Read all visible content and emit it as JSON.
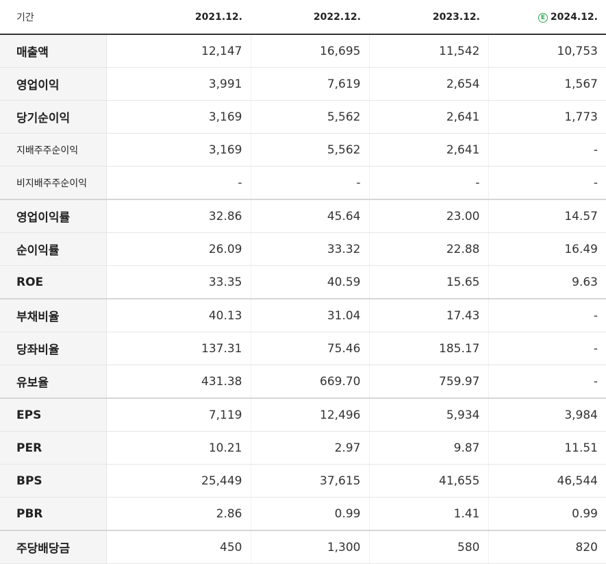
{
  "header": {
    "label": "기간",
    "periods": [
      "2021.12.",
      "2022.12.",
      "2023.12.",
      "2024.12."
    ],
    "estimate_badge": "E"
  },
  "rows": [
    {
      "label": "매출액",
      "values": [
        "12,147",
        "16,695",
        "11,542",
        "10,753"
      ]
    },
    {
      "label": "영업이익",
      "values": [
        "3,991",
        "7,619",
        "2,654",
        "1,567"
      ]
    },
    {
      "label": "당기순이익",
      "values": [
        "3,169",
        "5,562",
        "2,641",
        "1,773"
      ]
    },
    {
      "label": "지배주주순이익",
      "values": [
        "3,169",
        "5,562",
        "2,641",
        "-"
      ]
    },
    {
      "label": "비지배주주순이익",
      "values": [
        "-",
        "-",
        "-",
        "-"
      ]
    },
    {
      "label": "영업이익률",
      "values": [
        "32.86",
        "45.64",
        "23.00",
        "14.57"
      ]
    },
    {
      "label": "순이익률",
      "values": [
        "26.09",
        "33.32",
        "22.88",
        "16.49"
      ]
    },
    {
      "label": "ROE",
      "values": [
        "33.35",
        "40.59",
        "15.65",
        "9.63"
      ]
    },
    {
      "label": "부채비율",
      "values": [
        "40.13",
        "31.04",
        "17.43",
        "-"
      ]
    },
    {
      "label": "당좌비율",
      "values": [
        "137.31",
        "75.46",
        "185.17",
        "-"
      ]
    },
    {
      "label": "유보율",
      "values": [
        "431.38",
        "669.70",
        "759.97",
        "-"
      ]
    },
    {
      "label": "EPS",
      "values": [
        "7,119",
        "12,496",
        "5,934",
        "3,984"
      ]
    },
    {
      "label": "PER",
      "values": [
        "10.21",
        "2.97",
        "9.87",
        "11.51"
      ]
    },
    {
      "label": "BPS",
      "values": [
        "25,449",
        "37,615",
        "41,655",
        "46,544"
      ]
    },
    {
      "label": "PBR",
      "values": [
        "2.86",
        "0.99",
        "1.41",
        "0.99"
      ]
    },
    {
      "label": "주당배당금",
      "values": [
        "450",
        "1,300",
        "580",
        "820"
      ]
    }
  ]
}
